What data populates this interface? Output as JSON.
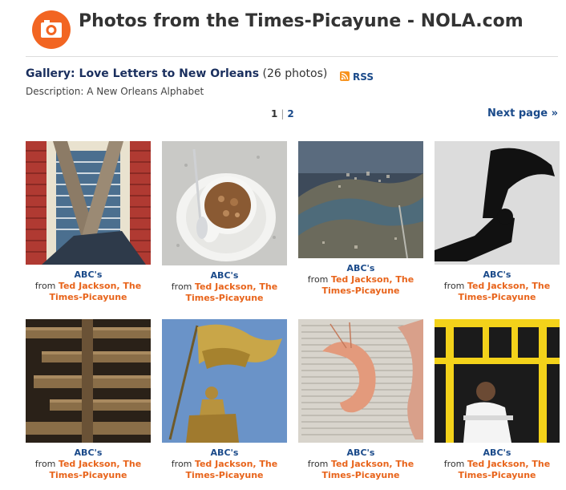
{
  "site": {
    "title": "Photos from the Times-Picayune - NOLA.com"
  },
  "gallery": {
    "label_prefix": "Gallery: ",
    "name": "Love Letters to New Orleans",
    "count_text": "(26 photos)",
    "rss_label": "RSS",
    "description": "Description: A New Orleans Alphabet"
  },
  "pager": {
    "current": "1",
    "separator": "|",
    "next_num": "2",
    "next_label": "Next page »"
  },
  "photos": [
    {
      "title": "ABC's",
      "from": "from ",
      "author_line1": "Ted Jackson, The",
      "author_line2": "Times-Picayune"
    },
    {
      "title": "ABC's",
      "from": "from ",
      "author_line1": "Ted Jackson, The",
      "author_line2": "Times-Picayune"
    },
    {
      "title": "ABC's",
      "from": "from ",
      "author_line1": "Ted Jackson, The",
      "author_line2": "Times-Picayune"
    },
    {
      "title": "ABC's",
      "from": "from ",
      "author_line1": "Ted Jackson, The",
      "author_line2": "Times-Picayune"
    },
    {
      "title": "ABC's",
      "from": "from ",
      "author_line1": "Ted Jackson, The",
      "author_line2": "Times-Picayune"
    },
    {
      "title": "ABC's",
      "from": "from ",
      "author_line1": "Ted Jackson, The",
      "author_line2": "Times-Picayune"
    },
    {
      "title": "ABC's",
      "from": "from ",
      "author_line1": "Ted Jackson, The",
      "author_line2": "Times-Picayune"
    },
    {
      "title": "ABC's",
      "from": "from ",
      "author_line1": "Ted Jackson, The",
      "author_line2": "Times-Picayune"
    }
  ],
  "colors": {
    "brand": "#f26522",
    "link": "#1a4a8a",
    "author": "#e8641b"
  }
}
